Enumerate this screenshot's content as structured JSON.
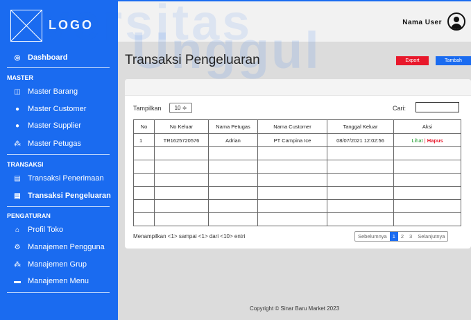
{
  "brand": {
    "logo_text": "LOGO"
  },
  "header": {
    "user_name": "Nama User"
  },
  "sidebar": {
    "dashboard": "Dashboard",
    "sections": [
      {
        "title": "MASTER",
        "items": [
          "Master Barang",
          "Master Customer",
          "Master Supplier",
          "Master Petugas"
        ]
      },
      {
        "title": "TRANSAKSI",
        "items": [
          "Transaksi Penerimaan",
          "Transaksi Pengeluaran"
        ]
      },
      {
        "title": "PENGATURAN",
        "items": [
          "Profil Toko",
          "Manajemen Pengguna",
          "Manajemen Grup",
          "Manajemen Menu"
        ]
      }
    ],
    "active_item": "Transaksi Pengeluaran"
  },
  "page": {
    "title": "Transaksi Pengeluaran",
    "export_label": "Export",
    "add_label": "Tambah"
  },
  "table_controls": {
    "show_label": "Tampilkan",
    "show_value": "10 ≑",
    "search_label": "Cari:"
  },
  "table": {
    "columns": [
      "No",
      "No Keluar",
      "Nama Petugas",
      "Nama Customer",
      "Tanggal Keluar",
      "Aksi"
    ],
    "rows": [
      {
        "no": "1",
        "no_keluar": "TR1625720576",
        "petugas": "Adrian",
        "customer": "PT Campina Ice",
        "tanggal": "08/07/2021 12:02:56",
        "view": "Lihat",
        "sep": "|",
        "del": "Hapus"
      }
    ]
  },
  "info_text": "Menampilkan <1> sampai <1> dari <10> entri",
  "pagination": {
    "prev": "Sebelumnya",
    "pages": [
      "1",
      "2",
      "3"
    ],
    "next": "Selanjutnya",
    "active_page": "1"
  },
  "footer": "Copyright © Sinar Baru Market 2023",
  "watermark": {
    "line1": "versitas",
    "line2": "Unggul"
  },
  "colors": {
    "primary": "#1a6bf0",
    "danger": "#e8182b",
    "success": "#1a9c2a"
  }
}
